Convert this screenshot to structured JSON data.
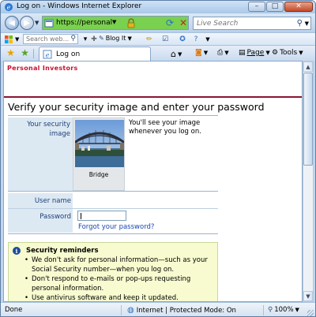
{
  "window": {
    "title": "Log on - Windows Internet Explorer",
    "controls": {
      "minimize": "–",
      "maximize": "□",
      "close": "✕"
    }
  },
  "address_bar": {
    "url": "https://personal",
    "ssl_color": "#7ad04f"
  },
  "search": {
    "placeholder": "Live Search"
  },
  "toolbar": {
    "search_placeholder": "Search web...",
    "blog_it_label": "Blog It"
  },
  "tabs": [
    {
      "label": "Log on"
    }
  ],
  "command_bar": {
    "page_label": "Page",
    "tools_label": "Tools"
  },
  "page": {
    "brand": "Personal Investors",
    "brand_color": "#c8102e",
    "title": "Verify your security image and enter your password",
    "security_image": {
      "label": "Your security image",
      "caption": "Bridge",
      "note": "You'll see your image whenever you log on."
    },
    "credentials": {
      "username_label": "User name",
      "username_value": "",
      "password_label": "Password",
      "password_value": "",
      "forgot_link": "Forgot your password?"
    },
    "reminders": {
      "title": "Security reminders",
      "items": [
        "We don't ask for personal information—such as your Social Security number—when you log on.",
        "Don't respond to e-mails or pop-ups requesting personal information.",
        "Use antivirus software and keep it updated."
      ]
    }
  },
  "status_bar": {
    "status": "Done",
    "zone": "Internet | Protected Mode: On",
    "zoom": "100%"
  }
}
